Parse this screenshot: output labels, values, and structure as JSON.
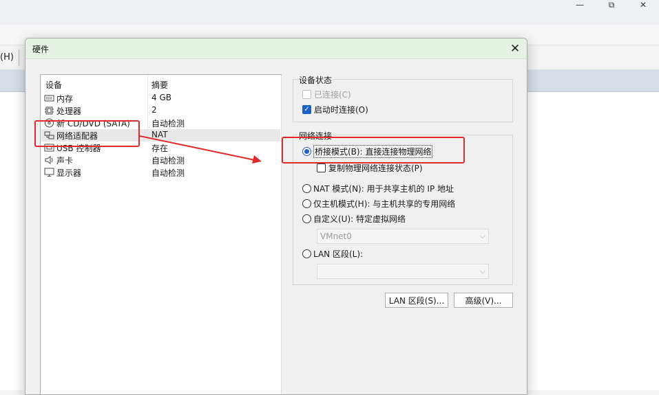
{
  "background": {
    "window_controls": {
      "minimize": "—",
      "restore": "⧉",
      "close": "✕"
    },
    "menu_help": "(H)"
  },
  "dialog": {
    "title": "硬件",
    "close_icon": "✕",
    "device_list": {
      "headers": {
        "device": "设备",
        "summary": "摘要"
      },
      "items": [
        {
          "icon": "memory-icon",
          "name": "内存",
          "summary": "4 GB"
        },
        {
          "icon": "processor-icon",
          "name": "处理器",
          "summary": "2"
        },
        {
          "icon": "cd-dvd-icon",
          "name": "新 CD/DVD (SATA)",
          "summary": "自动检测"
        },
        {
          "icon": "network-adapter-icon",
          "name": "网络适配器",
          "summary": "NAT",
          "selected": true
        },
        {
          "icon": "usb-icon",
          "name": "USB 控制器",
          "summary": "存在"
        },
        {
          "icon": "sound-card-icon",
          "name": "声卡",
          "summary": "自动检测"
        },
        {
          "icon": "display-icon",
          "name": "显示器",
          "summary": "自动检测"
        }
      ]
    },
    "device_status": {
      "legend": "设备状态",
      "connected": {
        "label": "已连接(C)",
        "checked": false,
        "enabled": false
      },
      "connect_at_power_on": {
        "label": "启动时连接(O)",
        "checked": true
      }
    },
    "network_connection": {
      "legend": "网络连接",
      "bridged": {
        "label": "桥接模式(B): 直接连接物理网络",
        "selected": true
      },
      "replicate": {
        "label": "复制物理网络连接状态(P)",
        "checked": false
      },
      "nat": {
        "label": "NAT 模式(N): 用于共享主机的 IP 地址"
      },
      "host_only": {
        "label": "仅主机模式(H): 与主机共享的专用网络"
      },
      "custom": {
        "label": "自定义(U): 特定虚拟网络",
        "value": "VMnet0"
      },
      "lan_segment": {
        "label": "LAN 区段(L):",
        "value": ""
      }
    },
    "buttons": {
      "lan_segments": "LAN 区段(S)...",
      "advanced": "高级(V)..."
    }
  },
  "colors": {
    "annotation": "#e12b2b",
    "accent": "#1e5fc8",
    "dialog_title_bg": "#e6f2e4"
  }
}
